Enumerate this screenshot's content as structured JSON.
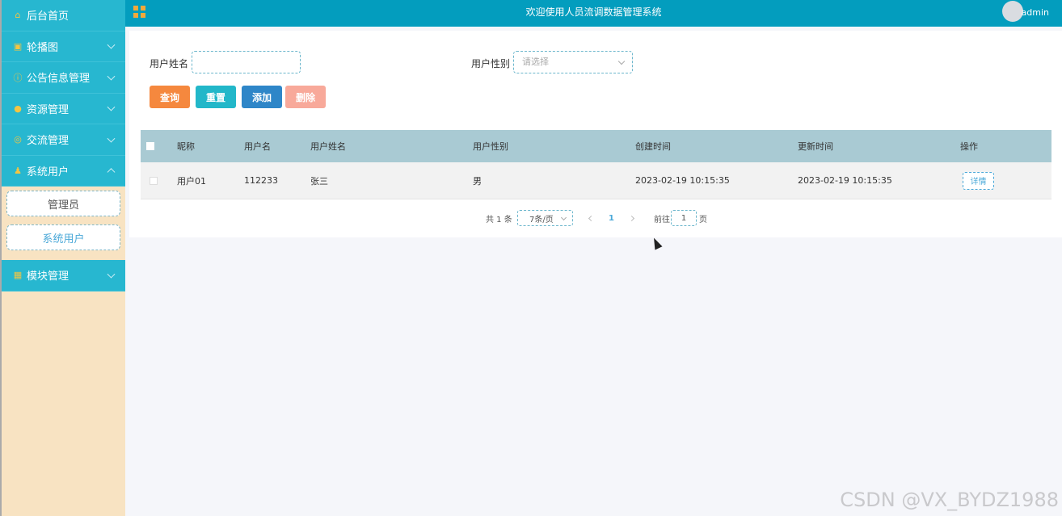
{
  "sidebar": {
    "items": [
      {
        "label": "后台首页",
        "icon": "home-icon"
      },
      {
        "label": "轮播图",
        "icon": "image-icon"
      },
      {
        "label": "公告信息管理",
        "icon": "info-icon"
      },
      {
        "label": "资源管理",
        "icon": "location-icon"
      },
      {
        "label": "交流管理",
        "icon": "chat-icon"
      },
      {
        "label": "系统用户",
        "icon": "user-icon",
        "expanded": true
      },
      {
        "label": "模块管理",
        "icon": "grid-icon"
      }
    ],
    "submenu": [
      {
        "label": "管理员"
      },
      {
        "label": "系统用户",
        "active": true
      }
    ]
  },
  "header": {
    "title": "欢迎使用人员流调数据管理系统",
    "username": "admin"
  },
  "search": {
    "name_label": "用户姓名",
    "name_value": "",
    "gender_label": "用户性别",
    "gender_placeholder": "请选择"
  },
  "buttons": {
    "query": "查询",
    "reset": "重置",
    "add": "添加",
    "delete": "删除"
  },
  "colors": {
    "query": "#f5883e",
    "reset": "#22b7c9",
    "add": "#2e86c8",
    "delete": "#f8a99a",
    "header": "#039dbe",
    "sidebar_item": "#27b7d0"
  },
  "table": {
    "columns": [
      "昵称",
      "用户名",
      "用户姓名",
      "用户性别",
      "创建时间",
      "更新时间",
      "操作"
    ],
    "rows": [
      {
        "nickname": "用户01",
        "username": "112233",
        "realname": "张三",
        "gender": "男",
        "created": "2023-02-19 10:15:35",
        "updated": "2023-02-19 10:15:35",
        "action": "详情"
      }
    ]
  },
  "pagination": {
    "total": "共 1 条",
    "page_size": "7条/页",
    "current_page": "1",
    "goto_label": "前往",
    "goto_value": "1",
    "goto_suffix": "页"
  },
  "watermark": "CSDN @VX_BYDZ1988"
}
